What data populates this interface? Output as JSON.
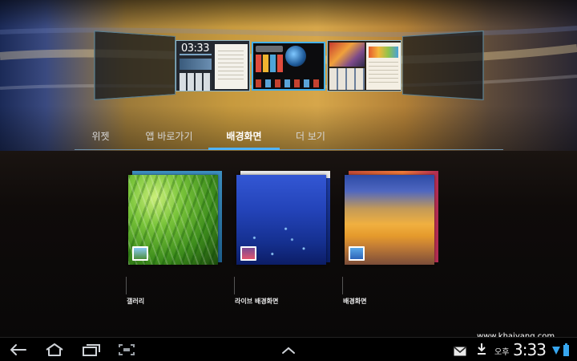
{
  "carousel": {
    "panel_clock": "03:33"
  },
  "tabs": [
    {
      "label": "위젯"
    },
    {
      "label": "앱 바로가기"
    },
    {
      "label": "배경화면"
    },
    {
      "label": "더 보기"
    }
  ],
  "active_tab": "배경화면",
  "items": [
    {
      "label": "갤러리"
    },
    {
      "label": "라이브 배경화면"
    },
    {
      "label": "배경화면"
    }
  ],
  "status_bar": {
    "ampm": "오후",
    "time": "3:33"
  },
  "watermark": "www.khaiyang.com",
  "colors": {
    "accent": "#4fb4ff",
    "background": "#0f0b0a"
  },
  "icons": [
    "back-icon",
    "home-icon",
    "recent-apps-icon",
    "screenshot-icon",
    "chevron-up-icon",
    "email-icon",
    "download-icon",
    "wifi-icon",
    "battery-icon"
  ]
}
